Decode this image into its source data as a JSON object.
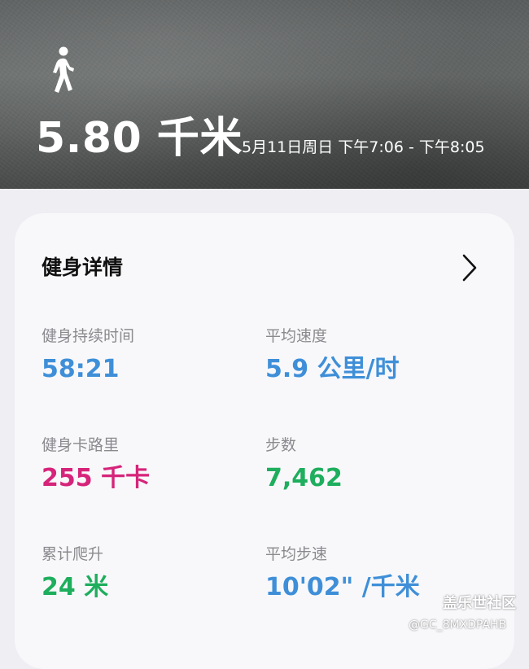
{
  "header": {
    "activity_icon": "walking-person-icon",
    "distance": "5.80 千米",
    "time_range": "5月11日周日 下午7:06 - 下午8:05"
  },
  "details": {
    "title": "健身详情",
    "chevron_icon": "chevron-right-icon",
    "stats": [
      {
        "label": "健身持续时间",
        "value": "58:21",
        "color": "#3f8fd8"
      },
      {
        "label": "平均速度",
        "value": "5.9 公里/时",
        "color": "#3f8fd8"
      },
      {
        "label": "健身卡路里",
        "value": "255 千卡",
        "color": "#d6247a"
      },
      {
        "label": "步数",
        "value": "7,462",
        "color": "#1eae5d"
      },
      {
        "label": "累计爬升",
        "value": "24 米",
        "color": "#1eae5d"
      },
      {
        "label": "平均步速",
        "value": "10'02\" /千米",
        "color": "#3f8fd8"
      }
    ]
  },
  "watermark": {
    "site": "盖乐世社区",
    "user": "@GC_8MXDPAHB"
  }
}
